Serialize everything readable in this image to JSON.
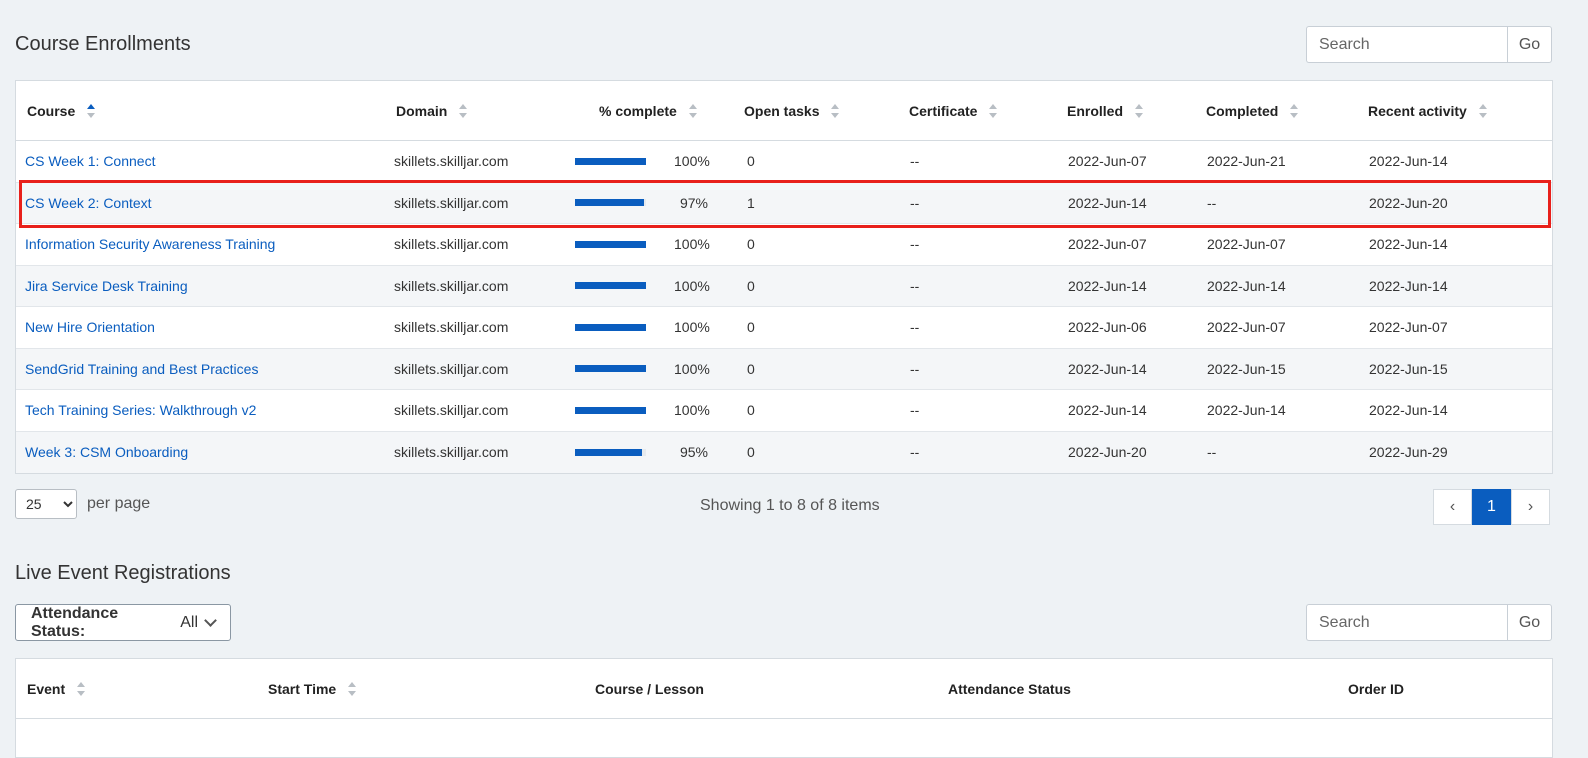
{
  "enrollments": {
    "title": "Course Enrollments",
    "search_placeholder": "Search",
    "go_label": "Go",
    "columns": [
      "Course",
      "Domain",
      "% complete",
      "Open tasks",
      "Certificate",
      "Enrolled",
      "Completed",
      "Recent activity"
    ],
    "rows": [
      {
        "course": "CS Week 1: Connect",
        "domain": "skillets.skilljar.com",
        "pct": "100%",
        "pct_value": 100,
        "open_tasks": "0",
        "certificate": "--",
        "enrolled": "2022-Jun-07",
        "completed": "2022-Jun-21",
        "recent": "2022-Jun-14"
      },
      {
        "course": "CS Week 2: Context",
        "domain": "skillets.skilljar.com",
        "pct": "97%",
        "pct_value": 97,
        "open_tasks": "1",
        "certificate": "--",
        "enrolled": "2022-Jun-14",
        "completed": "--",
        "recent": "2022-Jun-20"
      },
      {
        "course": "Information Security Awareness Training",
        "domain": "skillets.skilljar.com",
        "pct": "100%",
        "pct_value": 100,
        "open_tasks": "0",
        "certificate": "--",
        "enrolled": "2022-Jun-07",
        "completed": "2022-Jun-07",
        "recent": "2022-Jun-14"
      },
      {
        "course": "Jira Service Desk Training",
        "domain": "skillets.skilljar.com",
        "pct": "100%",
        "pct_value": 100,
        "open_tasks": "0",
        "certificate": "--",
        "enrolled": "2022-Jun-14",
        "completed": "2022-Jun-14",
        "recent": "2022-Jun-14"
      },
      {
        "course": "New Hire Orientation",
        "domain": "skillets.skilljar.com",
        "pct": "100%",
        "pct_value": 100,
        "open_tasks": "0",
        "certificate": "--",
        "enrolled": "2022-Jun-06",
        "completed": "2022-Jun-07",
        "recent": "2022-Jun-07"
      },
      {
        "course": "SendGrid Training and Best Practices",
        "domain": "skillets.skilljar.com",
        "pct": "100%",
        "pct_value": 100,
        "open_tasks": "0",
        "certificate": "--",
        "enrolled": "2022-Jun-14",
        "completed": "2022-Jun-15",
        "recent": "2022-Jun-15"
      },
      {
        "course": "Tech Training Series: Walkthrough v2",
        "domain": "skillets.skilljar.com",
        "pct": "100%",
        "pct_value": 100,
        "open_tasks": "0",
        "certificate": "--",
        "enrolled": "2022-Jun-14",
        "completed": "2022-Jun-14",
        "recent": "2022-Jun-14"
      },
      {
        "course": "Week 3: CSM Onboarding",
        "domain": "skillets.skilljar.com",
        "pct": "95%",
        "pct_value": 95,
        "open_tasks": "0",
        "certificate": "--",
        "enrolled": "2022-Jun-20",
        "completed": "--",
        "recent": "2022-Jun-29"
      }
    ],
    "per_page_value": "25",
    "per_page_label": "per page",
    "showing": "Showing 1 to 8 of 8 items",
    "pager": {
      "prev": "‹",
      "current": "1",
      "next": "›"
    }
  },
  "live_events": {
    "title": "Live Event Registrations",
    "attendance_label": "Attendance Status:",
    "attendance_value": "All",
    "search_placeholder": "Search",
    "go_label": "Go",
    "columns": [
      "Event",
      "Start Time",
      "Course / Lesson",
      "Attendance Status",
      "Order ID"
    ]
  },
  "colors": {
    "accent": "#0a5dbf",
    "highlight": "#e8201b"
  }
}
